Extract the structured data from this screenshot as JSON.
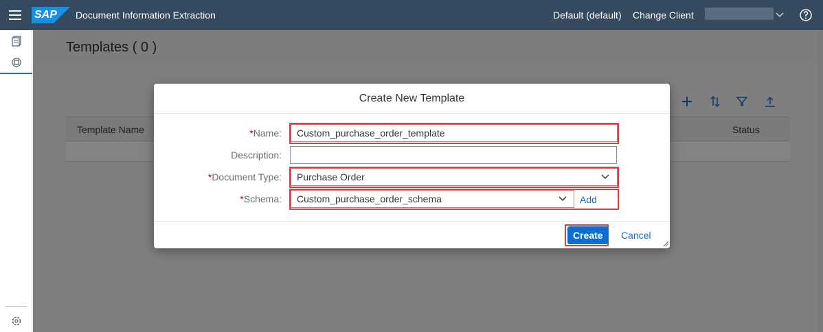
{
  "shellbar": {
    "logo_text": "SAP",
    "app_title": "Document Information Extraction",
    "client_label": "Default (default)",
    "change_client_label": "Change Client",
    "icons": [
      "menu-icon",
      "chevron-down-icon",
      "help-icon"
    ]
  },
  "sidenav": {
    "items": [
      {
        "icon": "document-icon"
      },
      {
        "icon": "templates-icon"
      },
      {
        "icon": "settings-icon"
      }
    ]
  },
  "page": {
    "title": "Templates ( 0 )",
    "toolbar_icons": [
      "add-icon",
      "sort-icon",
      "filter-icon",
      "upload-icon"
    ],
    "columns": [
      "Template Name",
      "Status"
    ]
  },
  "dialog": {
    "title": "Create New Template",
    "required_marker": "*",
    "fields": {
      "name": {
        "label": "Name:",
        "value": "Custom_purchase_order_template"
      },
      "description": {
        "label": "Description:",
        "value": ""
      },
      "document_type": {
        "label": "Document Type:",
        "value": "Purchase Order"
      },
      "schema": {
        "label": "Schema:",
        "value": "Custom_purchase_order_schema",
        "add_label": "Add"
      }
    },
    "create_label": "Create",
    "cancel_label": "Cancel",
    "highlight_color": "#e03b3b",
    "accent_color": "#0a6ed1"
  }
}
